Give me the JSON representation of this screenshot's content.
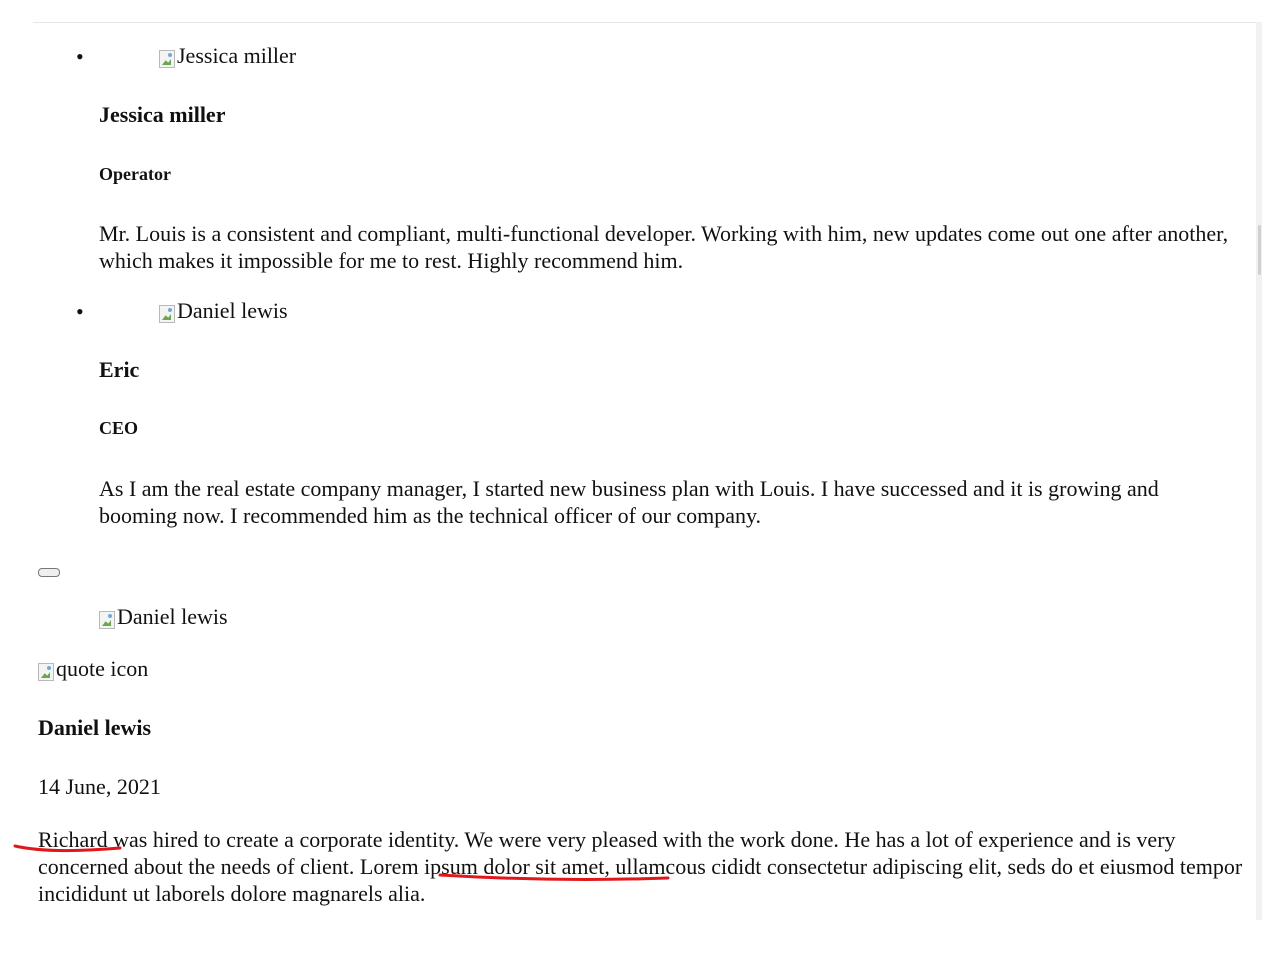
{
  "testimonials": [
    {
      "image_alt": "Jessica miller",
      "name": "Jessica miller",
      "role": "Operator",
      "text": "Mr. Louis is a consistent and compliant, multi-functional developer. Working with him, new updates come out one after another, which makes it impossible for me to rest. Highly recommend him."
    },
    {
      "image_alt": "Daniel lewis",
      "name": "Eric",
      "role": "CEO",
      "text": "As I am the real estate company manager, I started new business plan with Louis. I have successed and it is growing and booming now. I recommended him as the technical officer of our company."
    }
  ],
  "featured": {
    "image_alt": "Daniel lewis",
    "quote_icon_alt": "quote icon",
    "name": "Daniel lewis",
    "date": "14 June, 2021",
    "text_highlight_1": "Richard",
    "text_part_1": " was hired to create a corporate identity. We were very pleased with the work done. He has a lot of experience and is very concerned about the needs of client. ",
    "text_highlight_2": "Lorem ipsum dolor sit",
    "text_part_2": " amet, ullamcous cididt consectetur adipiscing elit, seds do et eiusmod tempor incididunt ut laborels dolore magnarels alia."
  },
  "colors": {
    "annotation_underline": "#e0171b"
  }
}
